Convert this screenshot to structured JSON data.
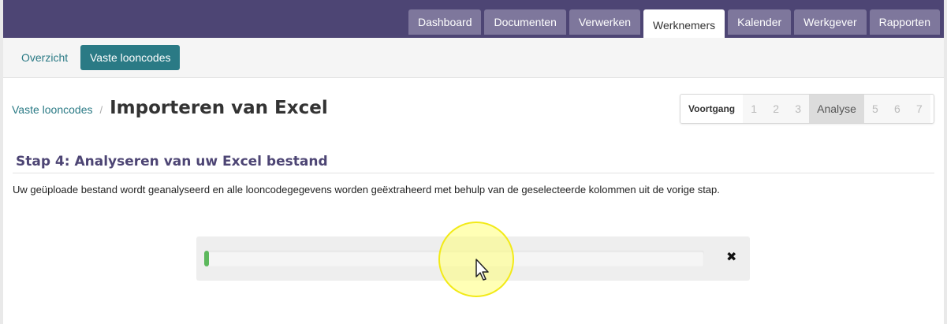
{
  "nav": {
    "tabs": [
      {
        "label": "Dashboard"
      },
      {
        "label": "Documenten"
      },
      {
        "label": "Verwerken"
      },
      {
        "label": "Werknemers"
      },
      {
        "label": "Kalender"
      },
      {
        "label": "Werkgever"
      },
      {
        "label": "Rapporten"
      }
    ],
    "active_tab": "Werknemers"
  },
  "subnav": {
    "items": [
      {
        "label": "Overzicht"
      },
      {
        "label": "Vaste looncodes"
      }
    ],
    "active_item": "Vaste looncodes"
  },
  "breadcrumb": {
    "parent": "Vaste looncodes",
    "separator": "/",
    "title": "Importeren van Excel"
  },
  "progress_steps": {
    "label": "Voortgang",
    "steps": [
      "1",
      "2",
      "3",
      "Analyse",
      "5",
      "6",
      "7"
    ],
    "current": "Analyse"
  },
  "section": {
    "title": "Stap 4: Analyseren van uw Excel bestand",
    "description": "Uw geüploade bestand wordt geanalyseerd en alle looncodegegevens worden geëxtraheerd met behulp van de geselecteerde kolommen uit de vorige stap."
  },
  "upload": {
    "progress_fraction": 0.01,
    "cancel_icon": "close-icon",
    "cancel_symbol": "✖"
  },
  "colors": {
    "header_bg": "#4d4574",
    "tab_bg": "#7e779c",
    "accent": "#2a7a85",
    "progress_fill": "#5cb85c"
  }
}
